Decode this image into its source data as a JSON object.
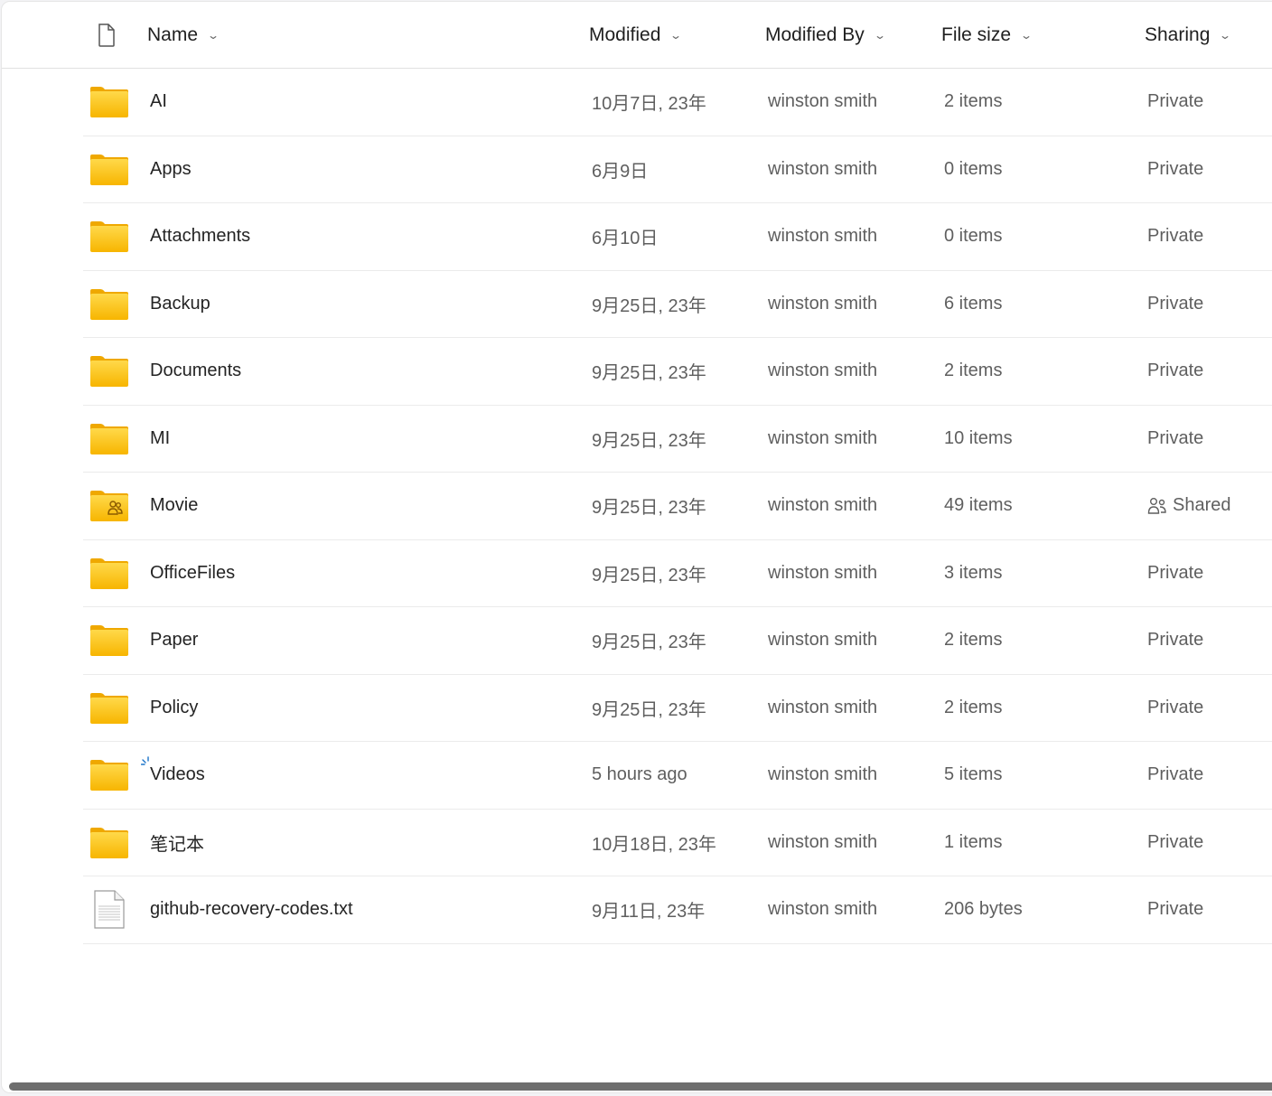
{
  "header": {
    "type_icon": "document-icon",
    "columns": [
      {
        "label": "Name",
        "sort_icon": "chevron-down-icon"
      },
      {
        "label": "Modified",
        "sort_icon": "chevron-down-icon"
      },
      {
        "label": "Modified By",
        "sort_icon": "chevron-down-icon"
      },
      {
        "label": "File size",
        "sort_icon": "chevron-down-icon"
      },
      {
        "label": "Sharing",
        "sort_icon": "chevron-down-icon"
      }
    ]
  },
  "rows": [
    {
      "name": "AI",
      "icon": "folder-icon",
      "modified": "10月7日, 23年",
      "modified_by": "winston smith",
      "size": "2 items",
      "sharing": "Private"
    },
    {
      "name": "Apps",
      "icon": "folder-icon",
      "modified": "6月9日",
      "modified_by": "winston smith",
      "size": "0 items",
      "sharing": "Private"
    },
    {
      "name": "Attachments",
      "icon": "folder-icon",
      "modified": "6月10日",
      "modified_by": "winston smith",
      "size": "0 items",
      "sharing": "Private"
    },
    {
      "name": "Backup",
      "icon": "folder-icon",
      "modified": "9月25日, 23年",
      "modified_by": "winston smith",
      "size": "6 items",
      "sharing": "Private"
    },
    {
      "name": "Documents",
      "icon": "folder-icon",
      "modified": "9月25日, 23年",
      "modified_by": "winston smith",
      "size": "2 items",
      "sharing": "Private"
    },
    {
      "name": "MI",
      "icon": "folder-icon",
      "modified": "9月25日, 23年",
      "modified_by": "winston smith",
      "size": "10 items",
      "sharing": "Private"
    },
    {
      "name": "Movie",
      "icon": "shared-folder-icon",
      "modified": "9月25日, 23年",
      "modified_by": "winston smith",
      "size": "49 items",
      "sharing": "Shared",
      "sharing_icon": "people-icon"
    },
    {
      "name": "OfficeFiles",
      "icon": "folder-icon",
      "modified": "9月25日, 23年",
      "modified_by": "winston smith",
      "size": "3 items",
      "sharing": "Private"
    },
    {
      "name": "Paper",
      "icon": "folder-icon",
      "modified": "9月25日, 23年",
      "modified_by": "winston smith",
      "size": "2 items",
      "sharing": "Private"
    },
    {
      "name": "Policy",
      "icon": "folder-icon",
      "modified": "9月25日, 23年",
      "modified_by": "winston smith",
      "size": "2 items",
      "sharing": "Private"
    },
    {
      "name": "Videos",
      "icon": "folder-icon",
      "new_indicator": "new-item-sparkle-icon",
      "modified": "5 hours ago",
      "modified_by": "winston smith",
      "size": "5 items",
      "sharing": "Private"
    },
    {
      "name": "笔记本",
      "icon": "folder-icon",
      "modified": "10月18日, 23年",
      "modified_by": "winston smith",
      "size": "1 items",
      "sharing": "Private"
    },
    {
      "name": "github-recovery-codes.txt",
      "icon": "text-file-icon",
      "modified": "9月11日, 23年",
      "modified_by": "winston smith",
      "size": "206 bytes",
      "sharing": "Private"
    }
  ],
  "colors": {
    "folder_top": "#ffd94a",
    "folder_bottom": "#f7b500",
    "folder_tab": "#efa800",
    "sparkle": "#1a73c9",
    "scrollbar": "#6e6e6e"
  }
}
